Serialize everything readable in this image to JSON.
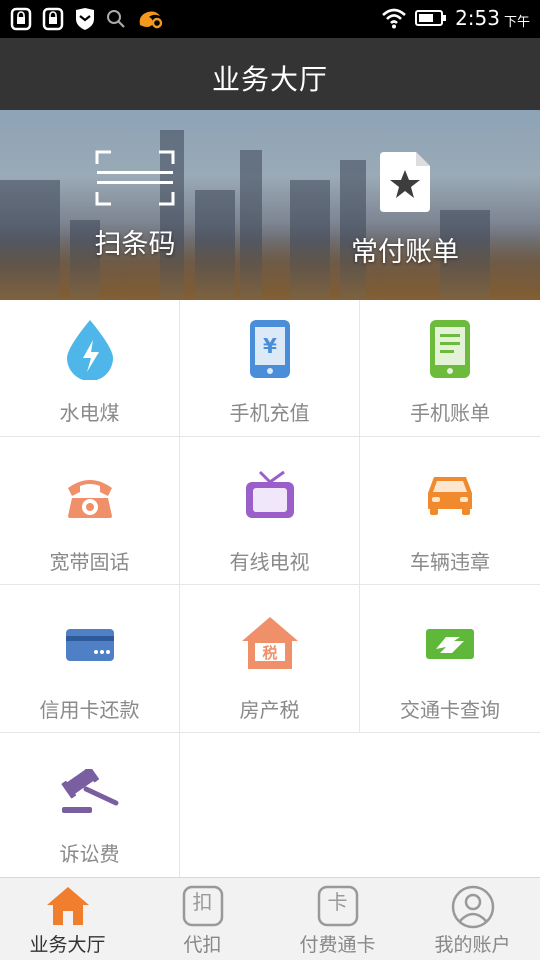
{
  "status_bar": {
    "time": "2:53",
    "ampm": "下午"
  },
  "header": {
    "title": "业务大厅"
  },
  "banner": {
    "items": [
      {
        "label": "扫条码",
        "icon": "barcode-scan-icon"
      },
      {
        "label": "常付账单",
        "icon": "favorite-bill-icon"
      }
    ]
  },
  "services": [
    {
      "label": "水电煤",
      "icon": "water-drop-icon",
      "color": "#4fb6ea"
    },
    {
      "label": "手机充值",
      "icon": "phone-recharge-icon",
      "color": "#4a8ed9"
    },
    {
      "label": "手机账单",
      "icon": "phone-bill-icon",
      "color": "#6dbb3c"
    },
    {
      "label": "宽带固话",
      "icon": "telephone-icon",
      "color": "#f0906a"
    },
    {
      "label": "有线电视",
      "icon": "tv-icon",
      "color": "#9a5fc9"
    },
    {
      "label": "车辆违章",
      "icon": "car-icon",
      "color": "#f08a2c"
    },
    {
      "label": "信用卡还款",
      "icon": "credit-card-icon",
      "color": "#4f80c6"
    },
    {
      "label": "房产税",
      "icon": "house-tax-icon",
      "color": "#f0906a"
    },
    {
      "label": "交通卡查询",
      "icon": "transit-card-icon",
      "color": "#5fb83a"
    },
    {
      "label": "诉讼费",
      "icon": "gavel-icon",
      "color": "#7a5fa0"
    }
  ],
  "bottom_nav": [
    {
      "label": "业务大厅",
      "icon": "home-icon",
      "active": true,
      "glyph": ""
    },
    {
      "label": "代扣",
      "icon": "deduct-icon",
      "active": false,
      "glyph": "扣"
    },
    {
      "label": "付费通卡",
      "icon": "card-icon",
      "active": false,
      "glyph": "卡"
    },
    {
      "label": "我的账户",
      "icon": "user-icon",
      "active": false,
      "glyph": ""
    }
  ],
  "colors": {
    "accent": "#f07e2e",
    "header_bg": "#343434"
  }
}
